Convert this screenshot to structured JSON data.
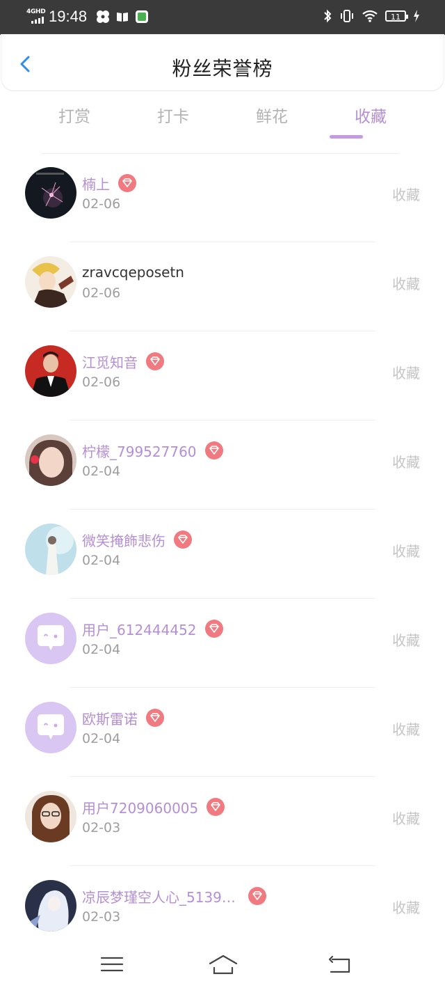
{
  "status_bar": {
    "network": "4GHD",
    "time": "19:48",
    "battery": "11"
  },
  "header": {
    "title": "粉丝荣誉榜"
  },
  "tabs": [
    {
      "label": "打赏",
      "active": false
    },
    {
      "label": "打卡",
      "active": false
    },
    {
      "label": "鲜花",
      "active": false
    },
    {
      "label": "收藏",
      "active": true
    }
  ],
  "fans": [
    {
      "name": "楠上",
      "date": "02-06",
      "badge": true,
      "action": "收藏",
      "avatar": "dark-sparkler"
    },
    {
      "name": "zravcqeposetn",
      "date": "02-06",
      "badge": false,
      "action": "收藏",
      "avatar": "blond-anime"
    },
    {
      "name": "江觅知音",
      "date": "02-06",
      "badge": true,
      "action": "收藏",
      "avatar": "man-suit-red"
    },
    {
      "name": "柠檬_799527760",
      "date": "02-04",
      "badge": true,
      "action": "收藏",
      "avatar": "girl-heart"
    },
    {
      "name": "微笑掩飾悲伤",
      "date": "02-04",
      "badge": true,
      "action": "收藏",
      "avatar": "pale-blue-figure"
    },
    {
      "name": "用户_612444452",
      "date": "02-04",
      "badge": true,
      "action": "收藏",
      "avatar": "default-chat"
    },
    {
      "name": "欧斯雷诺",
      "date": "02-04",
      "badge": true,
      "action": "收藏",
      "avatar": "default-chat"
    },
    {
      "name": "用户7209060005",
      "date": "02-03",
      "badge": true,
      "action": "收藏",
      "avatar": "woman-glasses"
    },
    {
      "name": "凉辰梦瑾空人心_5139…",
      "date": "02-03",
      "badge": true,
      "action": "收藏",
      "avatar": "anime-silver"
    }
  ],
  "colors": {
    "accent": "#b58ed6",
    "badge": "#f07a80",
    "back_arrow": "#2d8ee8",
    "status_bar": "#3a3a3a"
  },
  "icons": {
    "back": "chevron-left-icon",
    "badge": "diamond-icon",
    "nav": [
      "menu-icon",
      "home-icon",
      "back-icon"
    ]
  }
}
